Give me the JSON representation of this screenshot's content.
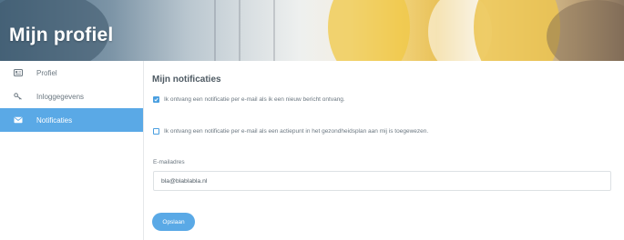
{
  "header": {
    "title": "Mijn profiel"
  },
  "sidebar": {
    "items": [
      {
        "label": "Profiel",
        "icon": "id-card-icon",
        "active": false
      },
      {
        "label": "Inloggegevens",
        "icon": "key-icon",
        "active": false
      },
      {
        "label": "Notificaties",
        "icon": "envelope-icon",
        "active": true
      }
    ]
  },
  "main": {
    "title": "Mijn notificaties",
    "options": [
      {
        "label": "Ik ontvang een notificatie per e-mail als ik een nieuw bericht ontvang.",
        "checked": true
      },
      {
        "label": "Ik ontvang een notificatie per e-mail als een actiepunt in het gezondheidsplan aan mij is toegewezen.",
        "checked": false
      }
    ],
    "email": {
      "label": "E-mailadres",
      "value": "bla@blablabla.nl"
    },
    "save_label": "Opslaan"
  },
  "colors": {
    "accent": "#5aa9e6",
    "checkbox": "#4a9fe0"
  }
}
